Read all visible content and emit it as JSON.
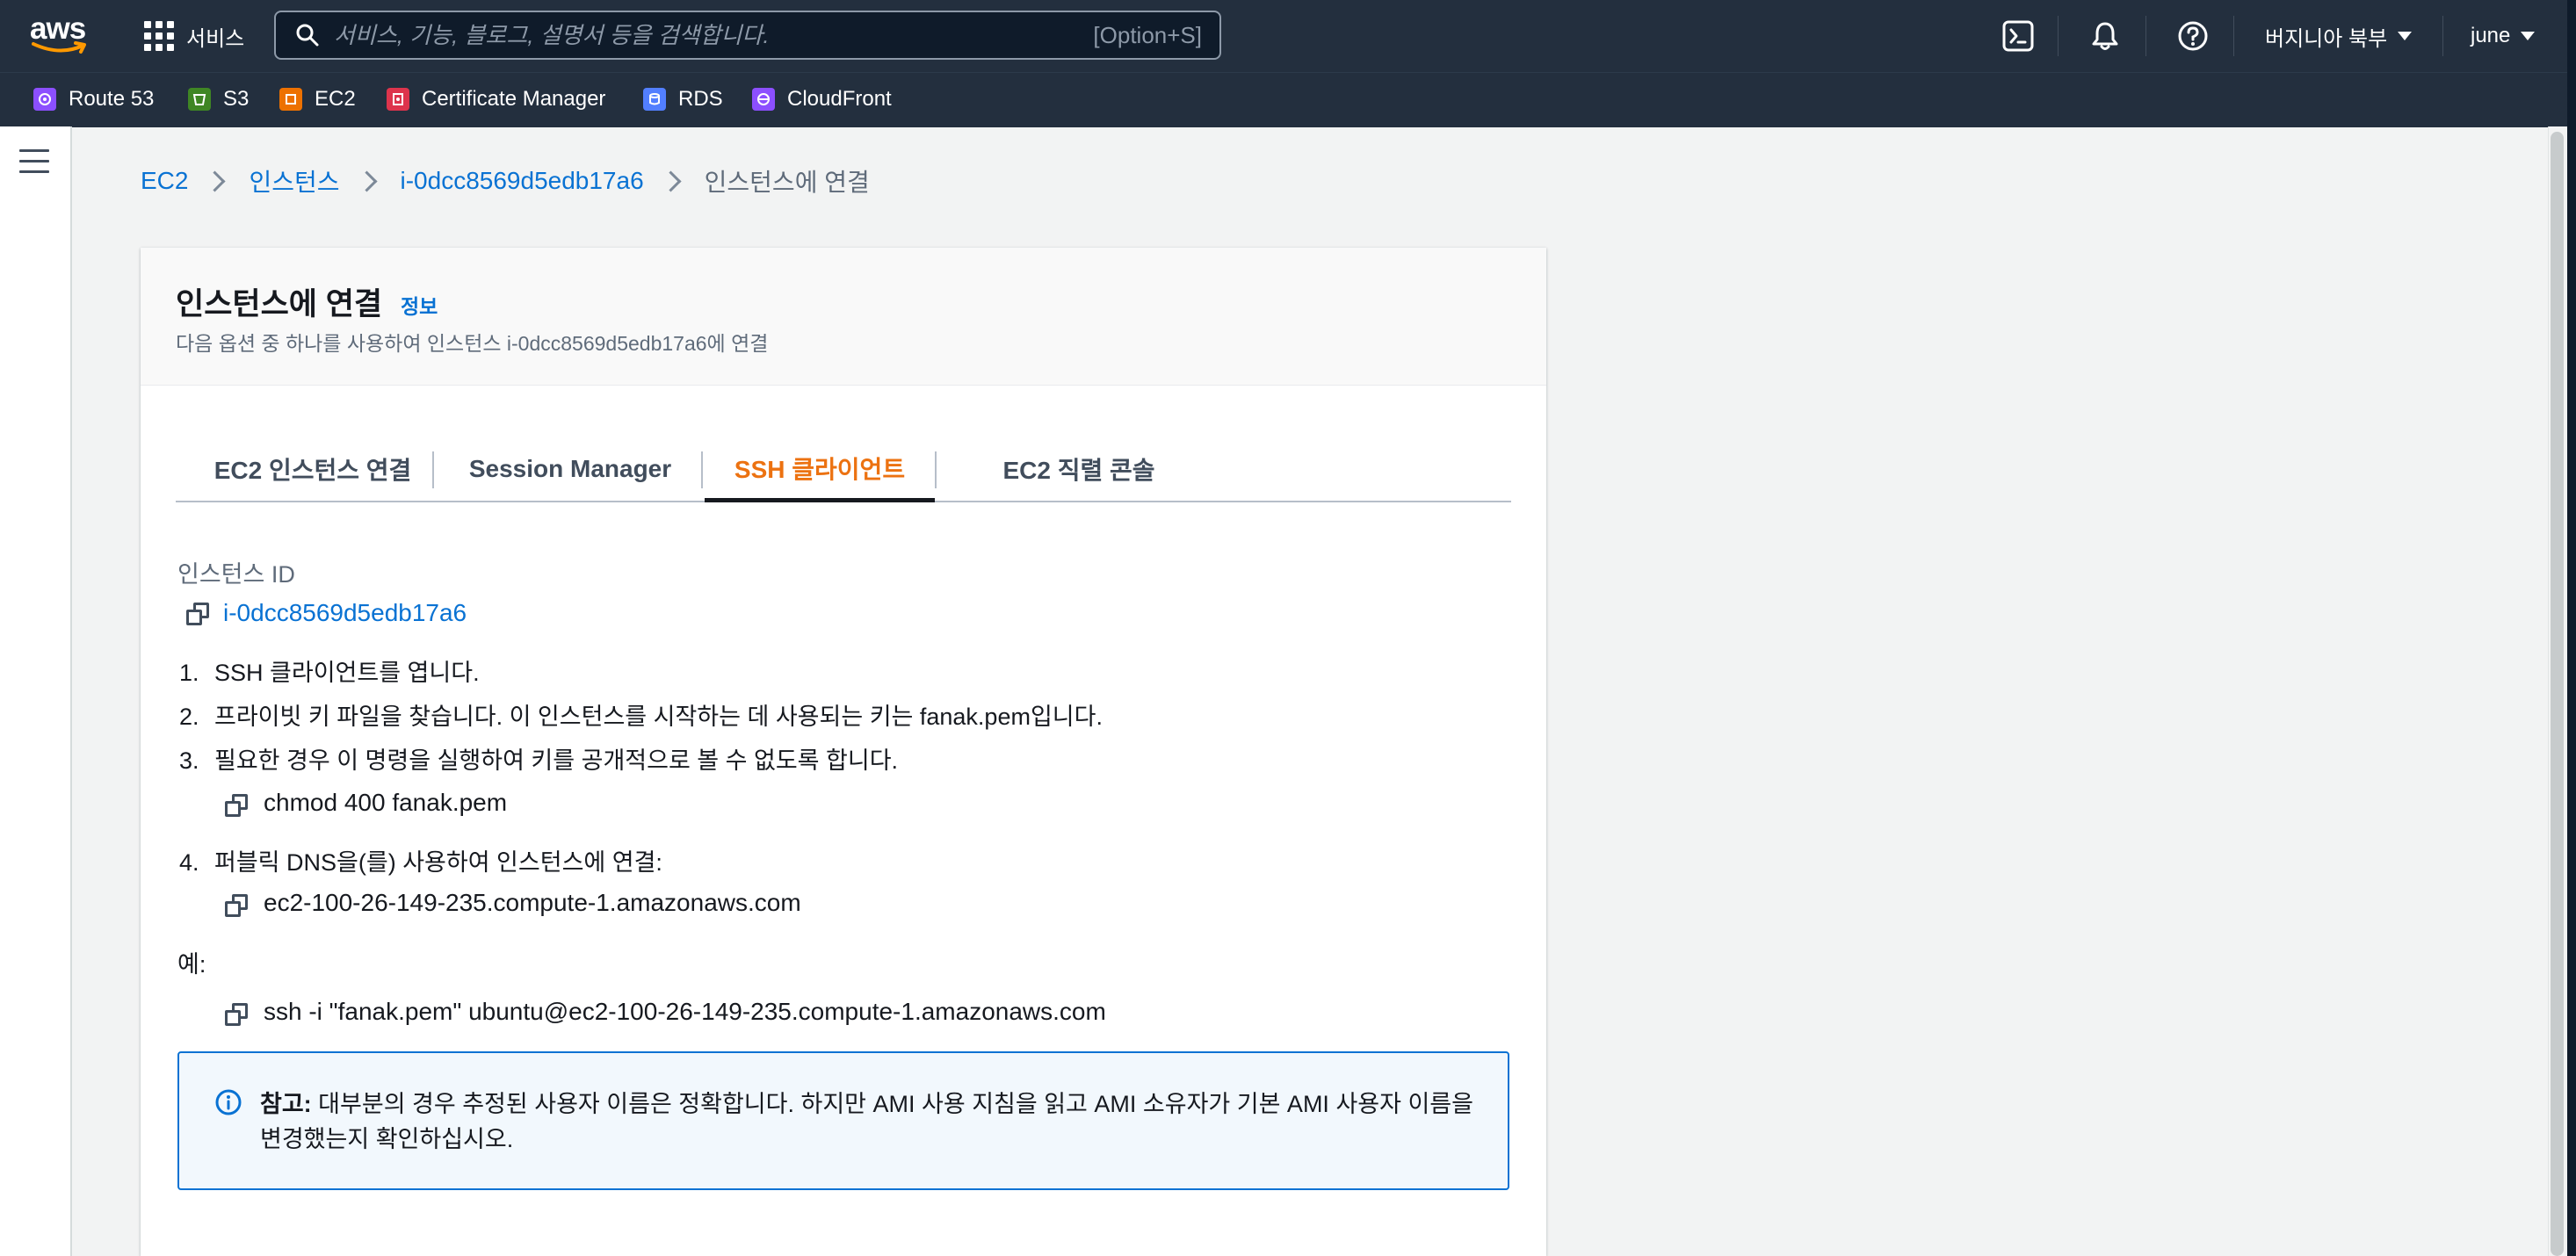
{
  "topnav": {
    "logo_text": "aws",
    "services_label": "서비스",
    "search_placeholder": "서비스, 기능, 블로그, 설명서 등을 검색합니다.",
    "search_shortcut": "[Option+S]",
    "region_label": "버지니아 북부",
    "user_label": "june"
  },
  "favorites": [
    {
      "label": "Route 53",
      "color": "#8c4fff"
    },
    {
      "label": "S3",
      "color": "#3f8624"
    },
    {
      "label": "EC2",
      "color": "#ed7100"
    },
    {
      "label": "Certificate Manager",
      "color": "#dd344c"
    },
    {
      "label": "RDS",
      "color": "#527fff"
    },
    {
      "label": "CloudFront",
      "color": "#8c4fff"
    }
  ],
  "breadcrumb": {
    "items": [
      "EC2",
      "인스턴스",
      "i-0dcc8569d5edb17a6"
    ],
    "current": "인스턴스에 연결"
  },
  "panel": {
    "title": "인스턴스에 연결",
    "info_link": "정보",
    "description": "다음 옵션 중 하나를 사용하여 인스턴스 i-0dcc8569d5edb17a6에 연결"
  },
  "tabs": [
    {
      "label": "EC2 인스턴스 연결",
      "active": false
    },
    {
      "label": "Session Manager",
      "active": false
    },
    {
      "label": "SSH 클라이언트",
      "active": true
    },
    {
      "label": "EC2 직렬 콘솔",
      "active": false
    }
  ],
  "content": {
    "instance_id_label": "인스턴스 ID",
    "instance_id": "i-0dcc8569d5edb17a6",
    "steps": [
      {
        "num": "1.",
        "text": "SSH 클라이언트를 엽니다."
      },
      {
        "num": "2.",
        "text": "프라이빗 키 파일을 찾습니다. 이 인스턴스를 시작하는 데 사용되는 키는 fanak.pem입니다."
      },
      {
        "num": "3.",
        "text": "필요한 경우 이 명령을 실행하여 키를 공개적으로 볼 수 없도록 합니다."
      },
      {
        "num": "4.",
        "text": "퍼블릭 DNS을(를) 사용하여 인스턴스에 연결:"
      }
    ],
    "chmod_command": "chmod 400 fanak.pem",
    "public_dns": "ec2-100-26-149-235.compute-1.amazonaws.com",
    "example_label": "예:",
    "ssh_command": "ssh -i \"fanak.pem\" ubuntu@ec2-100-26-149-235.compute-1.amazonaws.com",
    "note_label": "참고:",
    "note_text": " 대부분의 경우 추정된 사용자 이름은 정확합니다. 하지만 AMI 사용 지침을 읽고 AMI 소유자가 기본 AMI 사용자 이름을 변경했는지 확인하십시오."
  },
  "colors": {
    "nav_bg": "#232f3e",
    "link": "#0972d3",
    "active_tab": "#ec7211",
    "alert_bg": "#f2f8fd"
  }
}
